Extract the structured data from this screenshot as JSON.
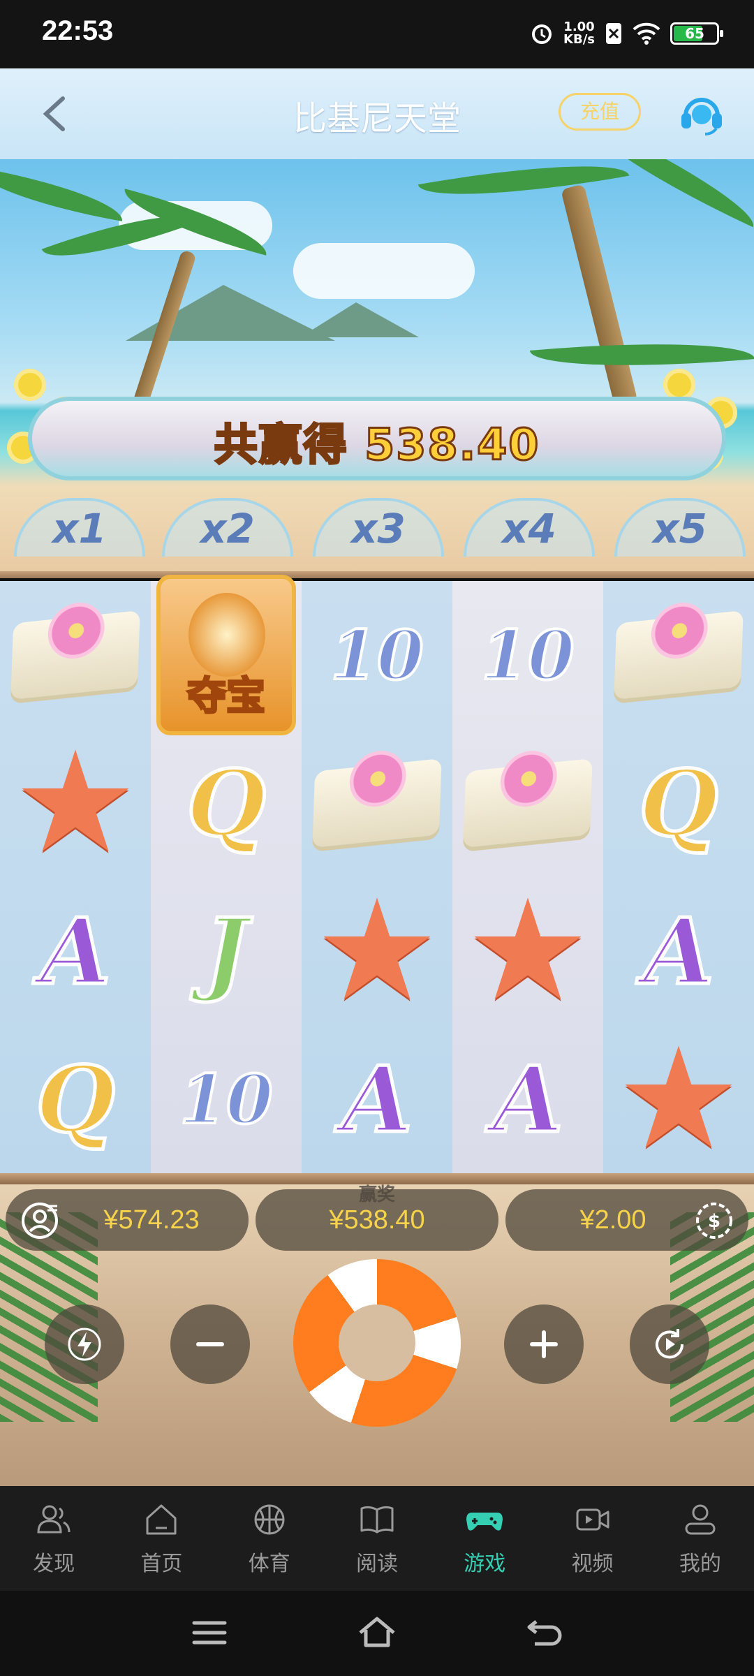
{
  "status_bar": {
    "time": "22:53",
    "net_speed_value": "1.00",
    "net_speed_unit": "KB/s",
    "battery_level": "65"
  },
  "header": {
    "title": "比基尼天堂",
    "recharge_label": "充值",
    "back_icon": "chevron-left-icon",
    "support_icon": "headset-icon"
  },
  "game": {
    "total_win_label": "共赢得 538.40",
    "multipliers": [
      "x1",
      "x2",
      "x3",
      "x4",
      "x5"
    ],
    "bonus_symbol_label": "夺宝",
    "reels": [
      [
        "towel-flower",
        "starfish",
        "A",
        "Q"
      ],
      [
        "bonus",
        "Q",
        "J",
        "10"
      ],
      [
        "10",
        "towel-flower",
        "starfish",
        "A"
      ],
      [
        "10",
        "towel-flower",
        "starfish",
        "A"
      ],
      [
        "towel-flower",
        "Q",
        "A",
        "starfish"
      ]
    ],
    "win_caption": "赢奖",
    "balance": "¥574.23",
    "win_amount": "¥538.40",
    "bet_amount": "¥2.00"
  },
  "controls": {
    "turbo_icon": "lightning-icon",
    "minus_icon": "minus-icon",
    "spin_icon": "life-ring-icon",
    "plus_icon": "plus-icon",
    "autoplay_icon": "autoplay-icon",
    "profile_icon": "user-menu-icon",
    "currency_icon": "coin-icon"
  },
  "bottom_nav": [
    {
      "label": "发现",
      "icon": "people-icon",
      "active": false
    },
    {
      "label": "首页",
      "icon": "home-icon",
      "active": false
    },
    {
      "label": "体育",
      "icon": "basketball-icon",
      "active": false
    },
    {
      "label": "阅读",
      "icon": "book-icon",
      "active": false
    },
    {
      "label": "游戏",
      "icon": "gamepad-icon",
      "active": true
    },
    {
      "label": "视频",
      "icon": "video-icon",
      "active": false
    },
    {
      "label": "我的",
      "icon": "user-icon",
      "active": false
    }
  ],
  "colors": {
    "accent_active": "#35d0b4",
    "win_text": "#ffcf3a",
    "pill_text": "#f6d34a"
  }
}
